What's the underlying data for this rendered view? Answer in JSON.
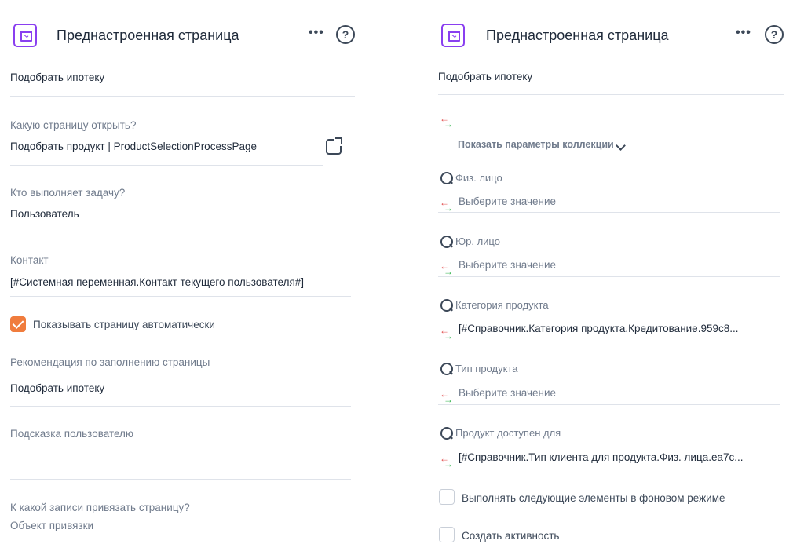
{
  "left": {
    "header": {
      "title": "Преднастроенная страница",
      "more_label": "•••",
      "help_label": "?"
    },
    "page_name": "Подобрать ипотеку",
    "page_to_open": {
      "label": "Какую страницу открыть?",
      "value": "Подобрать продукт | ProductSelectionProcessPage"
    },
    "executor": {
      "label": "Кто выполняет задачу?",
      "value": "Пользователь"
    },
    "contact": {
      "label": "Контакт",
      "value": "[#Системная переменная.Контакт текущего пользователя#]"
    },
    "auto_show": {
      "label": "Показывать страницу автоматически",
      "checked": true
    },
    "recommendation": {
      "label": "Рекомендация по заполнению страницы",
      "value": "Подобрать ипотеку"
    },
    "hint": {
      "label": "Подсказка пользователю",
      "value": ""
    },
    "binding": {
      "label": "К какой записи привязать страницу?",
      "value": "Объект привязки"
    }
  },
  "right": {
    "header": {
      "title": "Преднастроенная страница",
      "more_label": "•••",
      "help_label": "?"
    },
    "page_name": "Подобрать ипотеку",
    "show_collection_params": "Показать параметры коллекции",
    "params": [
      {
        "label": "Физ. лицо",
        "value": "Выберите значение",
        "is_placeholder": true
      },
      {
        "label": "Юр. лицо",
        "value": "Выберите значение",
        "is_placeholder": true
      },
      {
        "label": "Категория продукта",
        "value": "[#Справочник.Категория продукта.Кредитование.959c8...",
        "is_placeholder": false
      },
      {
        "label": "Тип продукта",
        "value": "Выберите значение",
        "is_placeholder": true
      },
      {
        "label": "Продукт доступен для",
        "value": "[#Справочник.Тип клиента для продукта.Физ. лица.ea7c...",
        "is_placeholder": false
      }
    ],
    "background_mode": {
      "label": "Выполнять следующие элементы в фоновом режиме",
      "checked": false
    },
    "create_activity": {
      "label": "Создать активность",
      "checked": false
    }
  },
  "colors": {
    "accent_purple": "#8a3ff0",
    "checkbox_orange": "#f07c3d",
    "arrow_red": "#e14b4b",
    "arrow_green": "#2fb34a"
  },
  "icons": [
    "page-icon",
    "more-icon",
    "help-icon",
    "external-link-icon",
    "swap-arrows-icon",
    "search-icon",
    "chevron-down-icon"
  ]
}
